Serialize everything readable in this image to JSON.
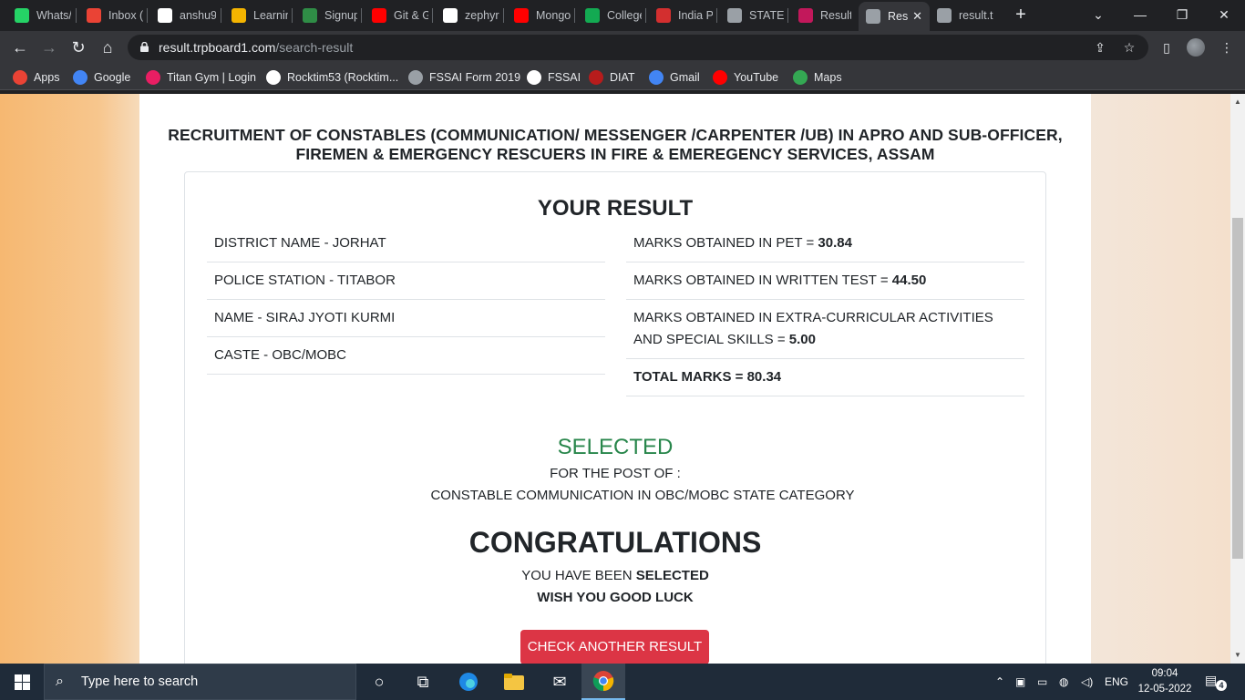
{
  "browser": {
    "tabs": [
      {
        "title": "Whats/",
        "icon": "whatsapp-icon",
        "color": "#25d366"
      },
      {
        "title": "Inbox (",
        "icon": "gmail-icon",
        "color": "#ea4335"
      },
      {
        "title": "anshu9",
        "icon": "github-icon",
        "color": "#ffffff"
      },
      {
        "title": "Learnin",
        "icon": "learning-icon",
        "color": "#f4b400"
      },
      {
        "title": "Signup",
        "icon": "gfg-icon",
        "color": "#2f8d46"
      },
      {
        "title": "Git & G",
        "icon": "youtube-icon",
        "color": "#ff0000"
      },
      {
        "title": "zephyr",
        "icon": "github-icon",
        "color": "#ffffff"
      },
      {
        "title": "Mongo",
        "icon": "youtube-icon",
        "color": "#ff0000"
      },
      {
        "title": "College",
        "icon": "leaf-icon",
        "color": "#13aa52"
      },
      {
        "title": "India P",
        "icon": "flag-icon",
        "color": "#d32f2f"
      },
      {
        "title": "STATE I",
        "icon": "globe-icon",
        "color": "#9aa0a6"
      },
      {
        "title": "Result",
        "icon": "emblem-icon",
        "color": "#c2185b"
      },
      {
        "title": "Res",
        "icon": "globe-icon",
        "color": "#9aa0a6"
      },
      {
        "title": "result.t",
        "icon": "globe-icon",
        "color": "#9aa0a6"
      }
    ],
    "active_tab_index": 12,
    "url_host": "result.trpboard1.com",
    "url_path": "/search-result",
    "bookmarks": [
      {
        "label": "Apps",
        "icon": "apps-grid-icon",
        "color": "#ea4335"
      },
      {
        "label": "Google",
        "icon": "google-icon",
        "color": "#4285f4"
      },
      {
        "label": "Titan Gym | Login",
        "icon": "titan-icon",
        "color": "#e91e63"
      },
      {
        "label": "Rocktim53 (Rocktim...",
        "icon": "github-icon",
        "color": "#ffffff"
      },
      {
        "label": "FSSAI Form 2019",
        "icon": "globe-icon",
        "color": "#9aa0a6"
      },
      {
        "label": "FSSAI",
        "icon": "fssai-icon",
        "color": "#ffffff"
      },
      {
        "label": "DIAT",
        "icon": "diat-icon",
        "color": "#b71c1c"
      },
      {
        "label": "Gmail",
        "icon": "google-icon",
        "color": "#4285f4"
      },
      {
        "label": "YouTube",
        "icon": "youtube-icon",
        "color": "#ff0000"
      },
      {
        "label": "Maps",
        "icon": "maps-icon",
        "color": "#34a853"
      }
    ]
  },
  "page": {
    "heading": "RECRUITMENT OF CONSTABLES (COMMUNICATION/ MESSENGER /CARPENTER /UB) IN APRO AND SUB-OFFICER, FIREMEN & EMERGENCY RESCUERS IN FIRE & EMEREGENCY SERVICES, ASSAM",
    "result_title": "YOUR RESULT",
    "candidate": [
      {
        "label": "DISTRICT NAME - JORHAT"
      },
      {
        "label": "POLICE STATION - TITABOR"
      },
      {
        "label": "NAME - SIRAJ JYOTI KURMI"
      },
      {
        "label": "CASTE - OBC/MOBC"
      }
    ],
    "marks": [
      {
        "label": "MARKS OBTAINED IN PET = ",
        "value": "30.84"
      },
      {
        "label": "MARKS OBTAINED IN WRITTEN TEST = ",
        "value": "44.50"
      },
      {
        "label": "MARKS OBTAINED IN EXTRA-CURRICULAR ACTIVITIES AND SPECIAL SKILLS = ",
        "value": "5.00"
      }
    ],
    "total": "TOTAL MARKS = 80.34",
    "status": "SELECTED",
    "status_color": "#28864b",
    "post_label": "FOR THE POST OF :",
    "post_value": "CONSTABLE COMMUNICATION IN OBC/MOBC STATE CATEGORY",
    "congrats": "CONGRATULATIONS",
    "been_selected_prefix": "YOU HAVE BEEN ",
    "been_selected_bold": "SELECTED",
    "good_luck": "WISH YOU GOOD LUCK",
    "check_button": "CHECK ANOTHER RESULT",
    "button_color": "#dc3545"
  },
  "taskbar": {
    "search_placeholder": "Type here to search",
    "language": "ENG",
    "time": "09:04",
    "date": "12-05-2022",
    "notification_count": "4"
  }
}
